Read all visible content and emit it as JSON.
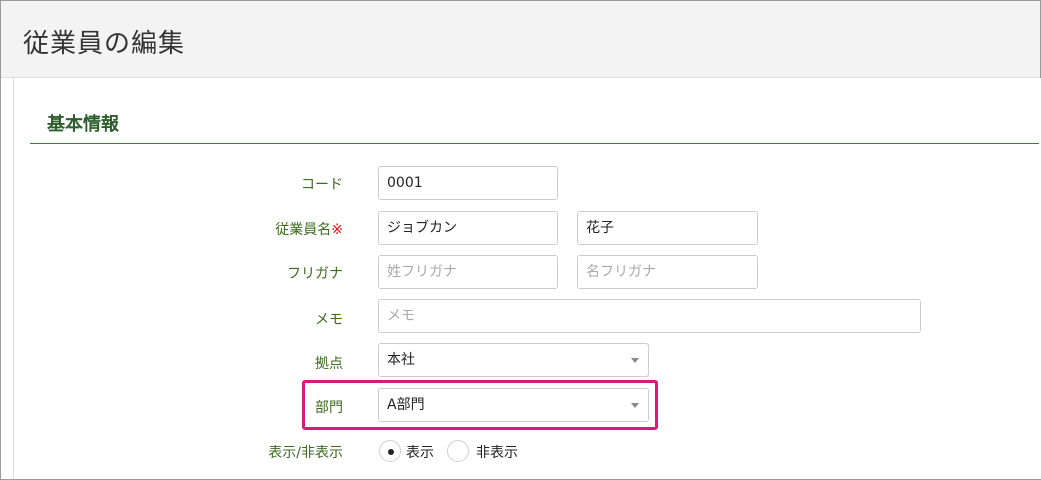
{
  "page": {
    "title": "従業員の編集"
  },
  "section": {
    "title": "基本情報"
  },
  "fields": {
    "code": {
      "label": "コード",
      "value": "0001"
    },
    "name": {
      "label": "従業員名",
      "required_mark": "※",
      "last_value": "ジョブカン",
      "first_value": "花子"
    },
    "furigana": {
      "label": "フリガナ",
      "last_placeholder": "姓フリガナ",
      "first_placeholder": "名フリガナ"
    },
    "memo": {
      "label": "メモ",
      "placeholder": "メモ"
    },
    "location": {
      "label": "拠点",
      "selected": "本社"
    },
    "department": {
      "label": "部門",
      "selected": "A部門"
    },
    "visibility": {
      "label": "表示/非表示",
      "options": [
        {
          "label": "表示",
          "checked": true
        },
        {
          "label": "非表示",
          "checked": false
        }
      ]
    }
  },
  "colors": {
    "label_green": "#3d6b1f",
    "section_green": "#2e5e2e",
    "highlight": "#d81b7a",
    "required": "#e01010"
  }
}
